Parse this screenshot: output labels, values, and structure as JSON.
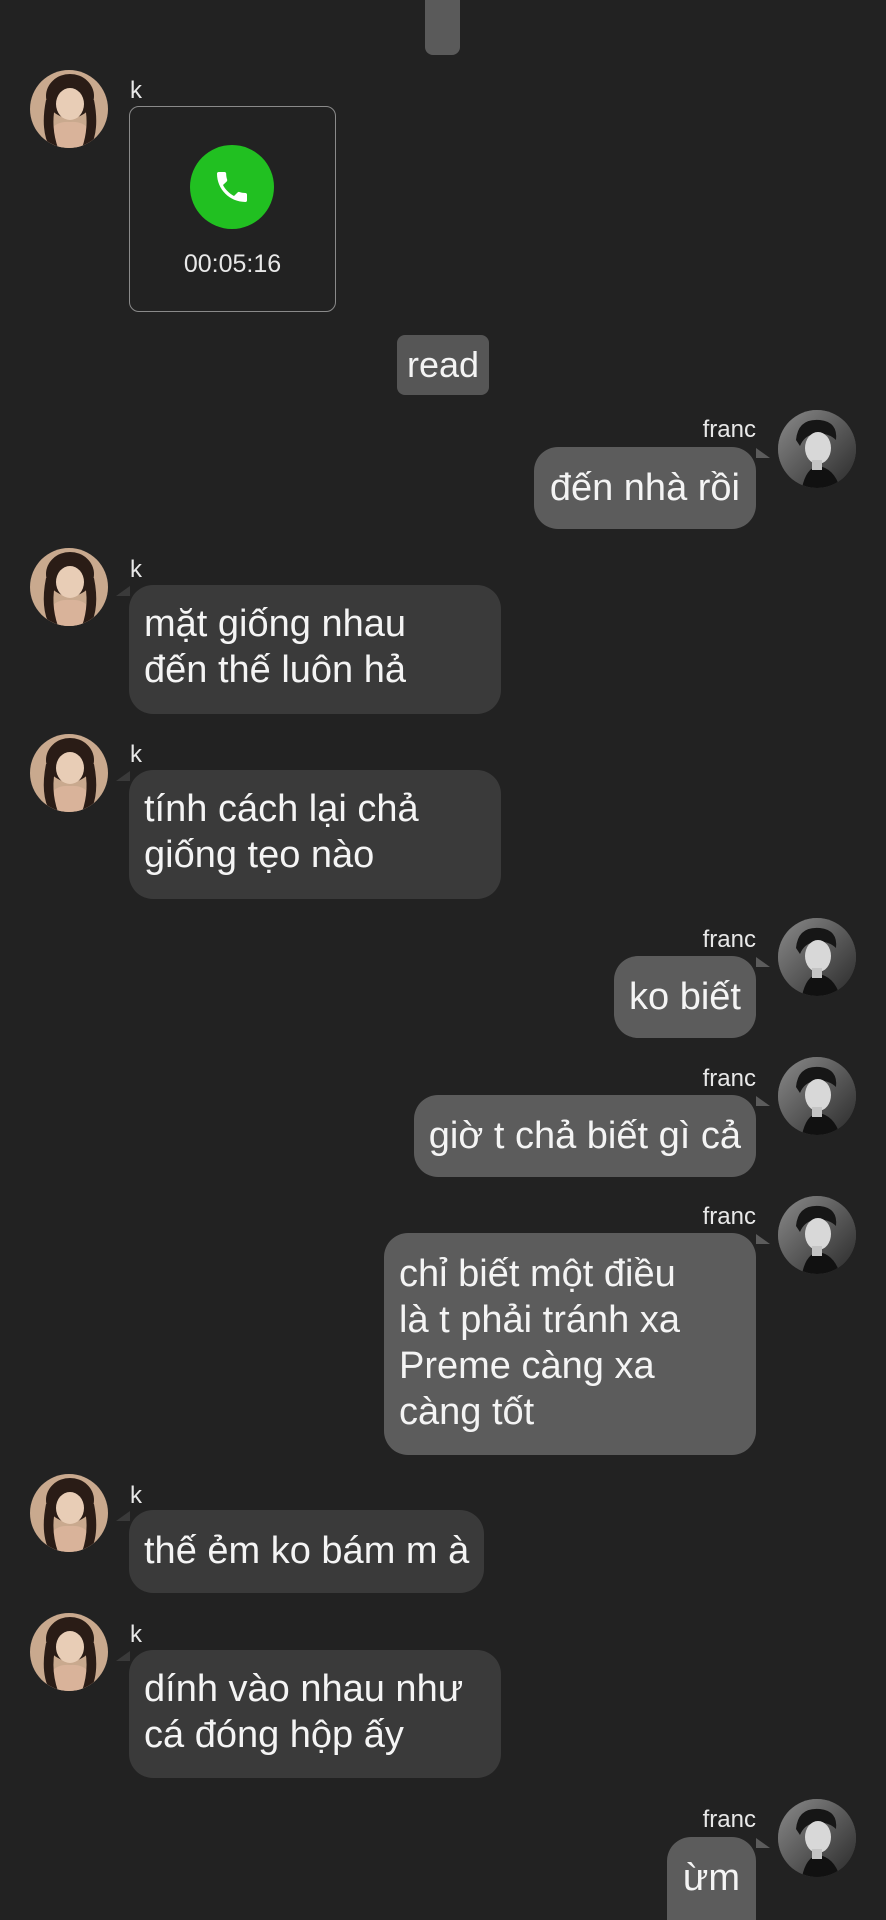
{
  "call": {
    "duration": "00:05:16"
  },
  "read_label": "read",
  "names": {
    "k": "k",
    "franc": "franc"
  },
  "messages": [
    "đến nhà rồi",
    "mặt giống nhau\nđến thế luôn hả",
    "tính cách lại chả\ngiống tẹo nào",
    "ko biết",
    "giờ t chả biết gì cả",
    "chỉ biết một điều\nlà t phải tránh xa\nPreme càng xa\ncàng tốt",
    "thế ẻm ko bám m à",
    "dính vào nhau như\ncá đóng hộp ấy",
    "ừm"
  ],
  "colors": {
    "background": "#222222",
    "incoming": "#3a3a3a",
    "outgoing": "#5c5c5c",
    "call_green": "#21c021"
  },
  "icons": {
    "call": "phone-icon"
  }
}
